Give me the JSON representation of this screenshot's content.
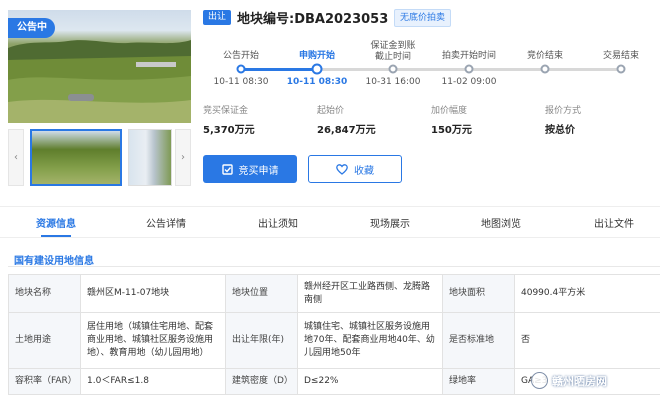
{
  "gallery": {
    "status_badge": "公告中",
    "prev_arrow": "‹",
    "next_arrow": "›"
  },
  "header": {
    "out_tag": "出让",
    "title": "地块编号:DBA2023053",
    "type_tag": "无底价拍卖"
  },
  "timeline": {
    "steps": [
      {
        "label": "公告开始",
        "time": "10-11 08:30"
      },
      {
        "label": "申购开始",
        "time": "10-11 08:30"
      },
      {
        "label": "保证金到账\n截止时间",
        "time": "10-31 16:00"
      },
      {
        "label": "拍卖开始时间",
        "time": "11-02 09:00"
      },
      {
        "label": "竞价结束",
        "time": ""
      },
      {
        "label": "交易结束",
        "time": ""
      }
    ]
  },
  "info": [
    {
      "label": "竞买保证金",
      "value": "5,370万元"
    },
    {
      "label": "起始价",
      "value": "26,847万元"
    },
    {
      "label": "加价幅度",
      "value": "150万元"
    },
    {
      "label": "报价方式",
      "value": "按总价"
    }
  ],
  "actions": {
    "apply": "竞买申请",
    "favorite": "收藏"
  },
  "tabs": [
    "资源信息",
    "公告详情",
    "出让须知",
    "现场展示",
    "地图浏览",
    "出让文件"
  ],
  "section_title": "国有建设用地信息",
  "table": {
    "r1": [
      "地块名称",
      "赣州区M-11-07地块",
      "地块位置",
      "赣州经开区工业路西侧、龙腾路南侧",
      "地块面积",
      "40990.4平方米"
    ],
    "r2": [
      "土地用途",
      "居住用地（城镇住宅用地、配套商业用地、城镇社区服务设施用地）、教育用地（幼儿园用地）",
      "出让年限(年)",
      "城镇住宅、城镇社区服务设施用地70年、配套商业用地40年、幼儿园用地50年",
      "是否标准地",
      "否"
    ],
    "r3": [
      "容积率（FAR）",
      "1.0＜FAR≤1.8",
      "建筑密度（D）",
      "D≤22%",
      "绿地率",
      "GA≥3"
    ]
  },
  "watermark": "赣州晒房网",
  "colors": {
    "accent": "#2a78e4"
  }
}
